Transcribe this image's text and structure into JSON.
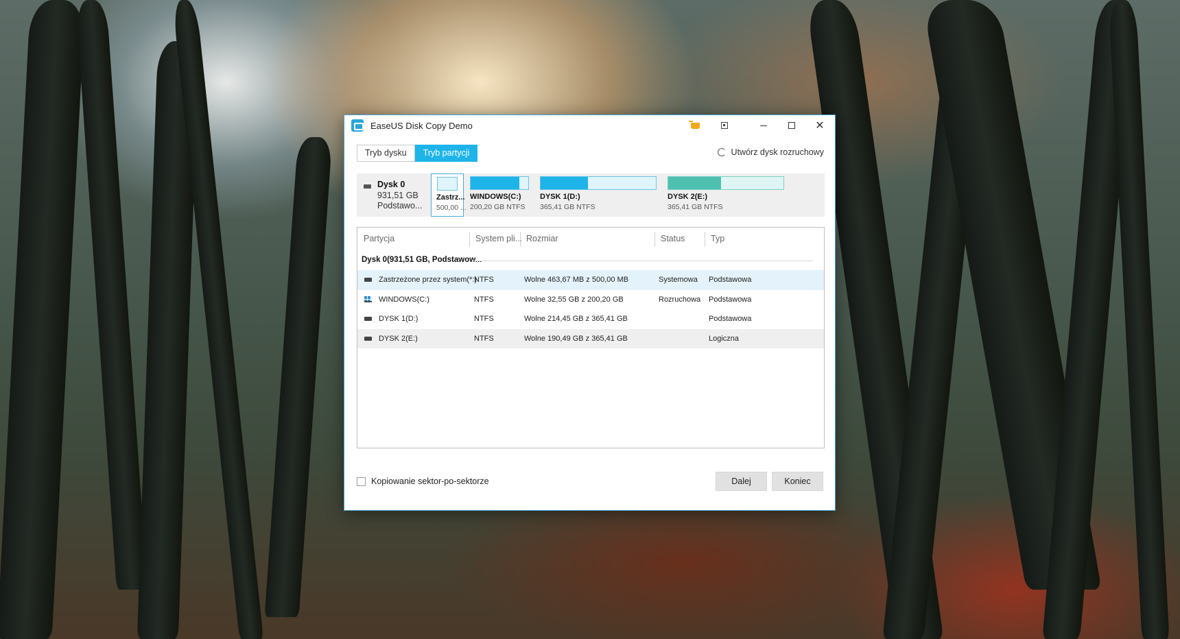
{
  "window": {
    "title": "EaseUS Disk Copy Demo",
    "icons": [
      "app-icon",
      "cart-icon",
      "restore-icon",
      "minimize-icon",
      "maximize-icon",
      "close-icon"
    ],
    "close_glyph": "✕"
  },
  "tabs": [
    {
      "label": "Tryb dysku",
      "active": false
    },
    {
      "label": "Tryb partycji",
      "active": true
    }
  ],
  "bootable_label": "Utwórz dysk rozruchowy",
  "disk": {
    "name": "Dysk 0",
    "size": "931,51 GB",
    "type": "Podstawo..."
  },
  "partitions_map": [
    {
      "name": "Zastrz...",
      "info": "500,00 ...",
      "used_fraction": 0.0,
      "selected": true
    },
    {
      "name": "WINDOWS(C:)",
      "info": "200,20 GB NTFS",
      "used_fraction": 0.84
    },
    {
      "name": "DYSK 1(D:)",
      "info": "365,41 GB NTFS",
      "used_fraction": 0.41
    },
    {
      "name": "DYSK 2(E:)",
      "info": "365,41 GB NTFS",
      "used_fraction": 0.46
    }
  ],
  "table": {
    "headers": [
      "Partycja",
      "System pli...",
      "Rozmiar",
      "Status",
      "Typ"
    ],
    "group": "Dysk 0(931,51 GB, Podstawow...",
    "rows": [
      {
        "name": "Zastrzeżone przez system(*:)",
        "fs": "NTFS",
        "size": "Wolne 463,67 MB z 500,00 MB",
        "status": "Systemowa",
        "type": "Podstawowa"
      },
      {
        "name": "WINDOWS(C:)",
        "fs": "NTFS",
        "size": "Wolne 32,55 GB z 200,20 GB",
        "status": "Rozruchowa",
        "type": "Podstawowa"
      },
      {
        "name": "DYSK 1(D:)",
        "fs": "NTFS",
        "size": "Wolne 214,45 GB z 365,41 GB",
        "status": "",
        "type": "Podstawowa"
      },
      {
        "name": "DYSK 2(E:)",
        "fs": "NTFS",
        "size": "Wolne 190,49 GB z 365,41 GB",
        "status": "",
        "type": "Logiczna"
      }
    ]
  },
  "sector_copy_label": "Kopiowanie sektor-po-sektorze",
  "buttons": {
    "next": "Dalej",
    "end": "Koniec"
  },
  "colors": {
    "accent": "#1eb4ea",
    "teal": "#4fc0b0",
    "selected_row": "#e4f2fb"
  }
}
